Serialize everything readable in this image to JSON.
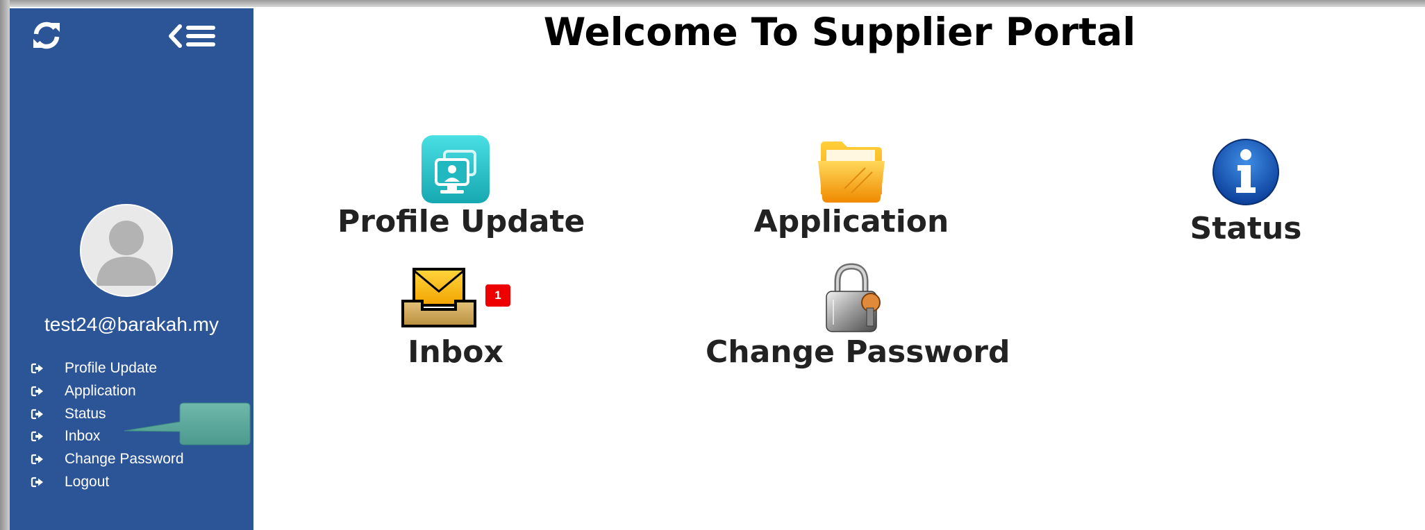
{
  "page": {
    "title": "Welcome To Supplier Portal"
  },
  "sidebar": {
    "username": "test24@barakah.my",
    "menu": [
      {
        "label": "Profile Update",
        "icon": "sign-out-icon"
      },
      {
        "label": "Application",
        "icon": "sign-out-icon"
      },
      {
        "label": "Status",
        "icon": "sign-out-icon"
      },
      {
        "label": "Inbox",
        "icon": "sign-out-icon"
      },
      {
        "label": "Change Password",
        "icon": "sign-out-icon"
      },
      {
        "label": "Logout",
        "icon": "sign-out-icon"
      }
    ]
  },
  "tiles": {
    "profile_update": {
      "label": "Profile Update",
      "icon": "profile-card-icon"
    },
    "application": {
      "label": "Application",
      "icon": "folder-icon"
    },
    "status": {
      "label": "Status",
      "icon": "info-icon"
    },
    "inbox": {
      "label": "Inbox",
      "icon": "inbox-tray-icon",
      "badge": "1"
    },
    "change_password": {
      "label": "Change Password",
      "icon": "padlock-icon"
    }
  },
  "colors": {
    "sidebar_bg": "#2c5597",
    "badge_bg": "#ef0000",
    "tooltip_bg": "#5aa79b"
  }
}
